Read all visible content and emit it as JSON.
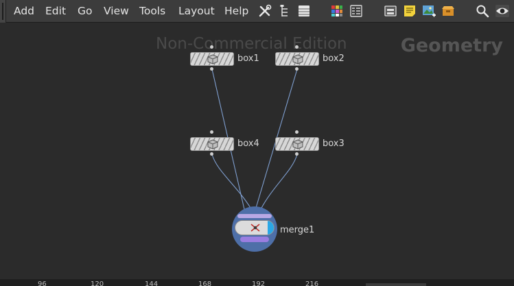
{
  "menu": {
    "items": [
      {
        "id": "add",
        "label": "Add"
      },
      {
        "id": "edit",
        "label": "Edit"
      },
      {
        "id": "go",
        "label": "Go"
      },
      {
        "id": "view",
        "label": "View"
      },
      {
        "id": "tools",
        "label": "Tools"
      },
      {
        "id": "layout",
        "label": "Layout"
      },
      {
        "id": "help",
        "label": "Help"
      }
    ]
  },
  "toolbar": {
    "icons": [
      "tools-icon",
      "tree-view-icon",
      "list-view-icon",
      "color-palette-icon",
      "grid-view-icon",
      "network-box-icon",
      "sticky-note-icon",
      "image-add-icon",
      "subnet-box-icon",
      "search-icon",
      "eye-icon"
    ]
  },
  "canvas": {
    "watermark": "Non-Commercial Edition",
    "context_label": "Geometry"
  },
  "nodes": [
    {
      "id": "box1",
      "label": "box1",
      "type": "box"
    },
    {
      "id": "box2",
      "label": "box2",
      "type": "box"
    },
    {
      "id": "box4",
      "label": "box4",
      "type": "box"
    },
    {
      "id": "box3",
      "label": "box3",
      "type": "box"
    },
    {
      "id": "merge1",
      "label": "merge1",
      "type": "merge"
    }
  ],
  "connections": [
    {
      "from": "box1",
      "to": "merge1"
    },
    {
      "from": "box2",
      "to": "merge1"
    },
    {
      "from": "box4",
      "to": "merge1"
    },
    {
      "from": "box3",
      "to": "merge1"
    }
  ],
  "timeline": {
    "ticks": [
      "96",
      "120",
      "144",
      "168",
      "192",
      "216"
    ]
  },
  "colors": {
    "background": "#2b2b2b",
    "menubar": "#3c3c3c",
    "wire": "#7f9fd0",
    "merge_node": "#4e6fa8",
    "merge_accent": "#2aa7e6",
    "node_body": "#d7d7d7"
  }
}
